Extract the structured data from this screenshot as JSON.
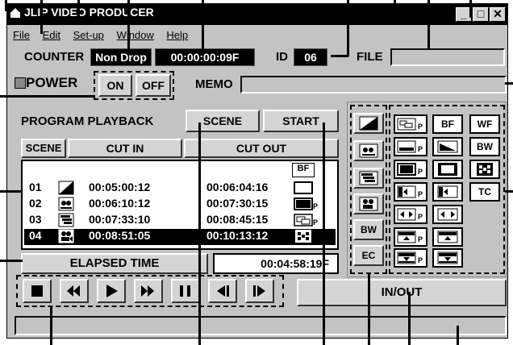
{
  "window": {
    "title": "JLIP VIDEO PRODUCER"
  },
  "menu": [
    "File",
    "Edit",
    "Set-up",
    "Window",
    "Help"
  ],
  "counter": {
    "label": "COUNTER",
    "mode": "Non Drop",
    "time": "00:00:00:09F"
  },
  "id": {
    "label": "ID",
    "value": "06"
  },
  "file": {
    "label": "FILE",
    "value": ""
  },
  "power": {
    "label": "POWER",
    "on": "ON",
    "off": "OFF"
  },
  "memo": {
    "label": "MEMO",
    "value": ""
  },
  "program": {
    "title": "PROGRAM PLAYBACK",
    "scene_button": "SCENE",
    "start_button": "START",
    "col_scene": "SCENE",
    "col_cut_in": "CUT IN",
    "col_cut_out": "CUT OUT",
    "header_effect": "BF",
    "rows": [
      {
        "scene": "01",
        "cut_in": "00:05:00:12",
        "cut_out": "00:06:04:16"
      },
      {
        "scene": "02",
        "cut_in": "00:06:10:12",
        "cut_out": "00:07:30:15"
      },
      {
        "scene": "03",
        "cut_in": "00:07:33:10",
        "cut_out": "00:08:45:15"
      },
      {
        "scene": "04",
        "cut_in": "00:08:51:05",
        "cut_out": "00:10:13:12"
      }
    ],
    "elapsed_label": "ELAPSED TIME",
    "elapsed_value": "00:04:58:19F"
  },
  "effects": {
    "left": [
      "",
      "",
      "",
      "",
      "BW",
      "EC"
    ],
    "grid_labels": {
      "bf": "BF",
      "wf": "WF",
      "tc": "TC",
      "bw": "BW"
    }
  },
  "transport": {
    "inout": "IN/OUT"
  },
  "status": ""
}
